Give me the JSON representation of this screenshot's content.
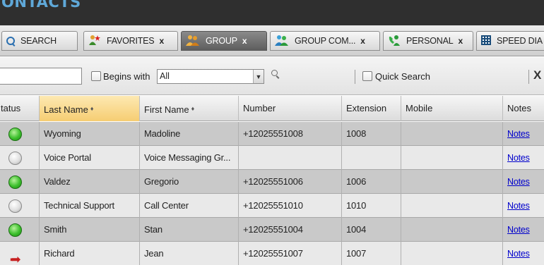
{
  "app": {
    "title": "ONTACTS"
  },
  "tabs": [
    {
      "label": "SEARCH",
      "icon": "search-icon",
      "closable": false
    },
    {
      "label": "FAVORITES",
      "icon": "favorites-icon",
      "closable": true,
      "close_label": "x"
    },
    {
      "label": "GROUP",
      "icon": "group-icon",
      "closable": true,
      "close_label": "x",
      "active": true
    },
    {
      "label": "GROUP COM...",
      "icon": "group-common-icon",
      "closable": true,
      "close_label": "x"
    },
    {
      "label": "PERSONAL",
      "icon": "personal-icon",
      "closable": true,
      "close_label": "x"
    },
    {
      "label": "SPEED DIA",
      "icon": "speed-dial-icon",
      "closable": false
    }
  ],
  "filter": {
    "search_value": "",
    "begins_with_label": "Begins with",
    "begins_with_value": "All",
    "quick_search_label": "Quick Search",
    "close_label": "X"
  },
  "table": {
    "columns": [
      "tatus",
      "Last Name",
      "First Name",
      "Number",
      "Extension",
      "Mobile",
      "Notes"
    ],
    "sort_indicator": "♦",
    "rows": [
      {
        "status": "available",
        "last": "Wyoming",
        "first": "Madoline",
        "number": "+12025551008",
        "ext": "1008",
        "mobile": "",
        "notes": "Notes"
      },
      {
        "status": "unknown",
        "last": "Voice Portal",
        "first": "Voice Messaging Gr...",
        "number": "",
        "ext": "",
        "mobile": "",
        "notes": "Notes"
      },
      {
        "status": "available",
        "last": "Valdez",
        "first": "Gregorio",
        "number": "+12025551006",
        "ext": "1006",
        "mobile": "",
        "notes": "Notes"
      },
      {
        "status": "unknown",
        "last": "Technical Support",
        "first": "Call Center",
        "number": "+12025551010",
        "ext": "1010",
        "mobile": "",
        "notes": "Notes"
      },
      {
        "status": "available",
        "last": "Smith",
        "first": "Stan",
        "number": "+12025551004",
        "ext": "1004",
        "mobile": "",
        "notes": "Notes"
      },
      {
        "status": "forwarding",
        "last": "Richard",
        "first": "Jean",
        "number": "+12025551007",
        "ext": "1007",
        "mobile": "",
        "notes": "Notes"
      }
    ]
  },
  "colors": {
    "title_blue": "#5fa8d8",
    "status_green": "#3cbf2c",
    "forward_red": "#c62020",
    "link_blue": "#0000cc",
    "sorted_header": "#f6cd72"
  }
}
